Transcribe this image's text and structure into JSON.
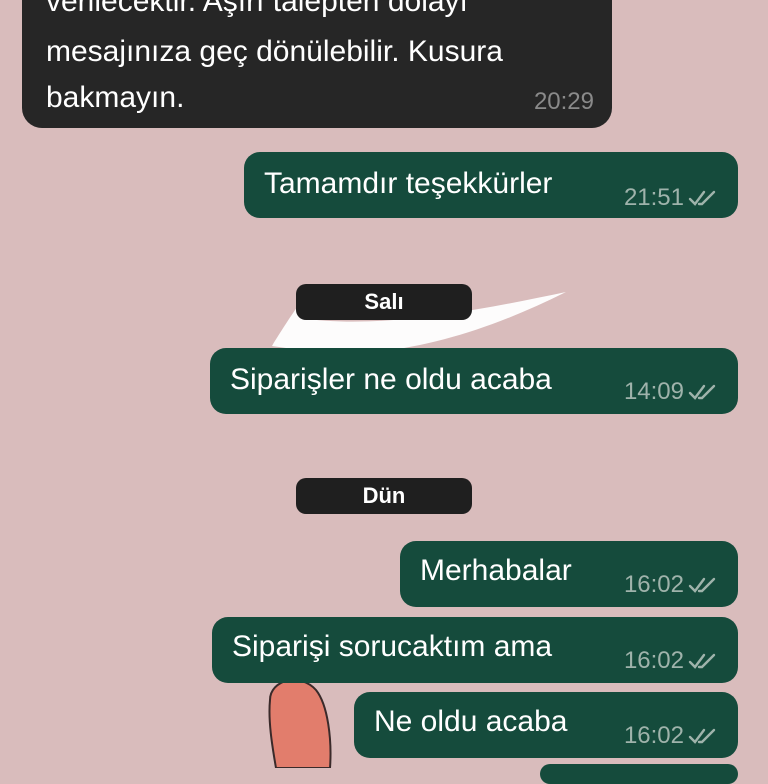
{
  "colors": {
    "background": "#d9bcbc",
    "incoming_bubble": "#262626",
    "outgoing_bubble": "#154b3c"
  },
  "incoming_message": {
    "lines": [
      "verilecektir. Aşırı talepten dolayı",
      "mesajınıza geç dönülebilir. Kusura",
      "bakmayın."
    ],
    "time": "20:29"
  },
  "messages": [
    {
      "text": "Tamamdır teşekkürler",
      "time": "21:51",
      "status_icon": "double-check-icon"
    },
    {
      "text": "Siparişler ne oldu acaba",
      "time": "14:09",
      "status_icon": "double-check-icon"
    },
    {
      "text": "Merhabalar",
      "time": "16:02",
      "status_icon": "double-check-icon"
    },
    {
      "text": "Siparişi sorucaktım ama",
      "time": "16:02",
      "status_icon": "double-check-icon"
    },
    {
      "text": "Ne oldu acaba",
      "time": "16:02",
      "status_icon": "double-check-icon"
    }
  ],
  "date_separators": [
    "Salı",
    "Dün"
  ]
}
